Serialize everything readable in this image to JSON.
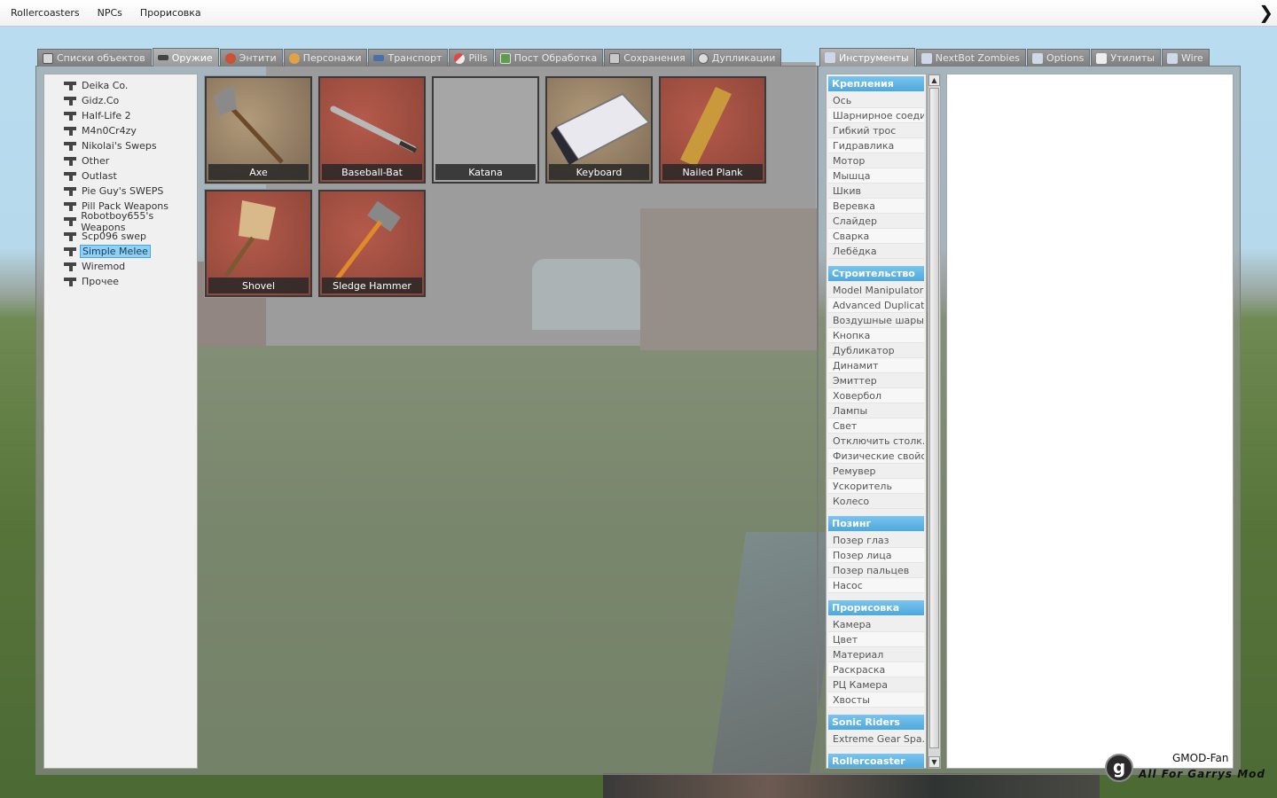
{
  "menubar": {
    "items": [
      "Rollercoasters",
      "NPCs",
      "Прорисовка"
    ]
  },
  "spawnmenu": {
    "tabs": [
      {
        "label": "Списки объектов",
        "icon": "grid-icon",
        "active": false
      },
      {
        "label": "Оружие",
        "icon": "gun-icon",
        "active": true
      },
      {
        "label": "Энтити",
        "icon": "entity-icon",
        "active": false
      },
      {
        "label": "Персонажи",
        "icon": "face-icon",
        "active": false
      },
      {
        "label": "Транспорт",
        "icon": "vehicle-icon",
        "active": false
      },
      {
        "label": "Pills",
        "icon": "pill-icon",
        "active": false
      },
      {
        "label": "Пост Обработка",
        "icon": "image-icon",
        "active": false
      },
      {
        "label": "Сохранения",
        "icon": "save-icon",
        "active": false
      },
      {
        "label": "Дупликации",
        "icon": "dupe-icon",
        "active": false
      }
    ],
    "categories": [
      "Deika Co.",
      "Gidz.Co",
      "Half-Life 2",
      "M4n0Cr4zy",
      "Nikolai's Sweps",
      "Other",
      "Outlast",
      "Pie Guy's SWEPS",
      "Pill Pack Weapons",
      "Robotboy655's Weapons",
      "Scp096 swep",
      "Simple Melee",
      "Wiremod",
      "Прочее"
    ],
    "selected_category": "Simple Melee",
    "weapons": [
      "Axe",
      "Baseball-Bat",
      "Katana",
      "Keyboard",
      "Nailed Plank",
      "Shovel",
      "Sledge Hammer"
    ]
  },
  "tools": {
    "tabs": [
      {
        "label": "Инструменты",
        "active": true
      },
      {
        "label": "NextBot Zombies",
        "active": false
      },
      {
        "label": "Options",
        "active": false
      },
      {
        "label": "Утилиты",
        "active": false
      },
      {
        "label": "Wire",
        "active": false
      }
    ],
    "categories": [
      {
        "header": "Крепления",
        "items": [
          "Ось",
          "Шарнирное соеди...",
          "Гибкий трос",
          "Гидравлика",
          "Мотор",
          "Мышца",
          "Шкив",
          "Веревка",
          "Слайдер",
          "Сварка",
          "Лебёдка"
        ]
      },
      {
        "header": "Строительство",
        "items": [
          "Model Manipulator",
          "Advanced Duplicator",
          "Воздушные шары",
          "Кнопка",
          "Дубликатор",
          "Динамит",
          "Эмиттер",
          "Ховербол",
          "Лампы",
          "Свет",
          "Отключить столк...",
          "Физические свойс...",
          "Ремувер",
          "Ускоритель",
          "Колесо"
        ]
      },
      {
        "header": "Позинг",
        "items": [
          "Позер глаз",
          "Позер лица",
          "Позер пальцев",
          "Насос"
        ]
      },
      {
        "header": "Прорисовка",
        "items": [
          "Камера",
          "Цвет",
          "Материал",
          "Раскраска",
          "РЦ Камера",
          "Хвосты"
        ]
      },
      {
        "header": "Sonic Riders",
        "items": [
          "Extreme Gear Spa..."
        ]
      },
      {
        "header": "Rollercoaster",
        "items": []
      }
    ]
  },
  "watermark": {
    "logo_letter": "g",
    "line1": "GMOD-Fan",
    "line2": "All For Garrys Mod"
  }
}
